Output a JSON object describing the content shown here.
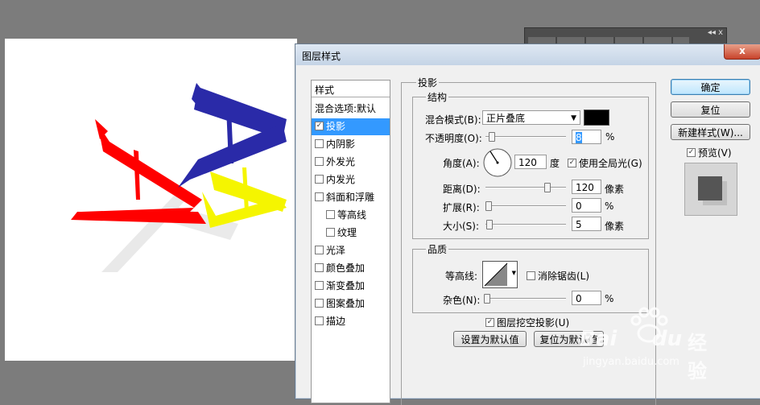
{
  "dialog": {
    "title": "图层样式",
    "close_label": "x"
  },
  "style_list": {
    "header": "样式",
    "blend_options": "混合选项:默认",
    "items": [
      {
        "label": "投影",
        "checked": true,
        "selected": true
      },
      {
        "label": "内阴影",
        "checked": false
      },
      {
        "label": "外发光",
        "checked": false
      },
      {
        "label": "内发光",
        "checked": false
      },
      {
        "label": "斜面和浮雕",
        "checked": false
      },
      {
        "label": "等高线",
        "checked": false,
        "sub": true
      },
      {
        "label": "纹理",
        "checked": false,
        "sub": true
      },
      {
        "label": "光泽",
        "checked": false
      },
      {
        "label": "颜色叠加",
        "checked": false
      },
      {
        "label": "渐变叠加",
        "checked": false
      },
      {
        "label": "图案叠加",
        "checked": false
      },
      {
        "label": "描边",
        "checked": false
      }
    ]
  },
  "drop_shadow": {
    "section_title": "投影",
    "structure": {
      "title": "结构",
      "blend_mode_label": "混合模式(B):",
      "blend_mode_value": "正片叠底",
      "blend_color": "#000000",
      "opacity_label": "不透明度(O):",
      "opacity_value": "8",
      "opacity_unit": "%",
      "angle_label": "角度(A):",
      "angle_value": "120",
      "angle_unit": "度",
      "global_light_label": "使用全局光(G)",
      "global_light_checked": true,
      "distance_label": "距离(D):",
      "distance_value": "120",
      "distance_unit": "像素",
      "spread_label": "扩展(R):",
      "spread_value": "0",
      "spread_unit": "%",
      "size_label": "大小(S):",
      "size_value": "5",
      "size_unit": "像素"
    },
    "quality": {
      "title": "品质",
      "contour_label": "等高线:",
      "antialias_label": "消除锯齿(L)",
      "antialias_checked": false,
      "noise_label": "杂色(N):",
      "noise_value": "0",
      "noise_unit": "%"
    },
    "knockout_label": "图层挖空投影(U)",
    "knockout_checked": true,
    "make_default_label": "设置为默认值",
    "reset_default_label": "复位为默认值"
  },
  "buttons": {
    "ok": "确定",
    "reset": "复位",
    "new_style": "新建样式(W)...",
    "preview_label": "预览(V)",
    "preview_checked": true
  },
  "watermark": {
    "brand": "Bai",
    "brand2": "du",
    "cn": "经验",
    "url": "jingyan.baidu.com"
  },
  "colors": {
    "red_letter": "#ff0000",
    "blue_letter": "#2a2aa8",
    "yellow_letter": "#f5f500",
    "selection": "#3399ff"
  }
}
